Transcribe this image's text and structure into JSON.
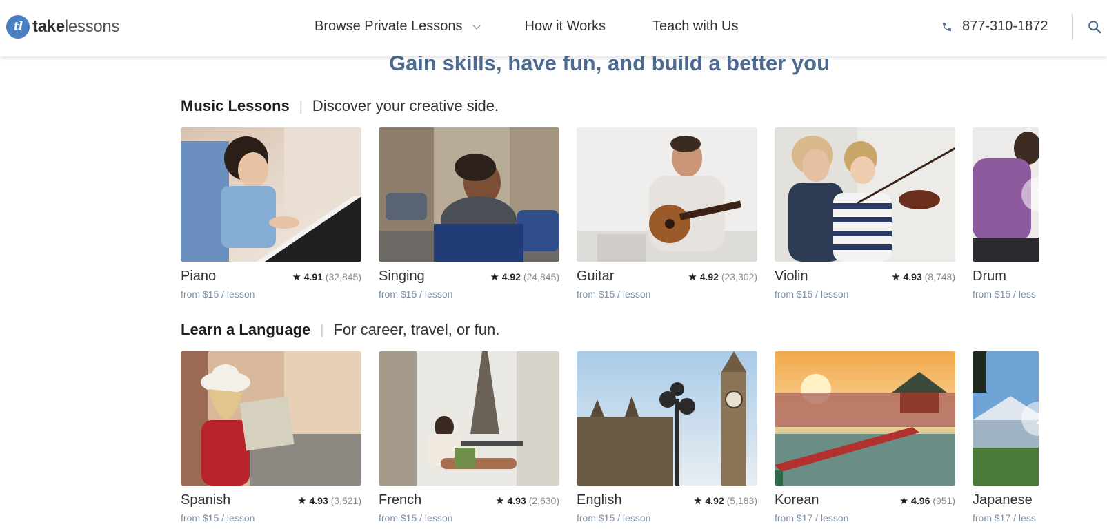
{
  "header": {
    "logo_prefix": "take",
    "logo_suffix": "lessons",
    "logo_mark": "tl",
    "nav": [
      {
        "label": "Browse Private Lessons",
        "has_dropdown": true
      },
      {
        "label": "How it Works"
      },
      {
        "label": "Teach with Us"
      }
    ],
    "phone": "877-310-1872",
    "icons": {
      "phone": "phone-icon",
      "search": "search-icon",
      "dropdown": "chevron-down-icon"
    }
  },
  "headline": "Gain skills, have fun, and build a better you",
  "music": {
    "title": "Music Lessons",
    "subtitle": "Discover your creative side.",
    "items": [
      {
        "name": "Piano",
        "rating": "4.91",
        "count": "(32,845)",
        "price": "from $15 / lesson"
      },
      {
        "name": "Singing",
        "rating": "4.92",
        "count": "(24,845)",
        "price": "from $15 / lesson"
      },
      {
        "name": "Guitar",
        "rating": "4.92",
        "count": "(23,302)",
        "price": "from $15 / lesson"
      },
      {
        "name": "Violin",
        "rating": "4.93",
        "count": "(8,748)",
        "price": "from $15 / lesson"
      },
      {
        "name": "Drum",
        "rating": "",
        "count": "",
        "price": "from $15 / less"
      }
    ]
  },
  "language": {
    "title": "Learn a Language",
    "subtitle": "For career, travel, or fun.",
    "items": [
      {
        "name": "Spanish",
        "rating": "4.93",
        "count": "(3,521)",
        "price": "from $15 / lesson"
      },
      {
        "name": "French",
        "rating": "4.93",
        "count": "(2,630)",
        "price": "from $15 / lesson"
      },
      {
        "name": "English",
        "rating": "4.92",
        "count": "(5,183)",
        "price": "from $15 / lesson"
      },
      {
        "name": "Korean",
        "rating": "4.96",
        "count": "(951)",
        "price": "from $17 / lesson"
      },
      {
        "name": "Japanese",
        "rating": "",
        "count": "",
        "price": "from $17 / less"
      }
    ]
  },
  "star_glyph": "★",
  "colors": {
    "brand": "#4a7fc1",
    "headline": "#4e6c93",
    "price": "#7c8fa6"
  }
}
